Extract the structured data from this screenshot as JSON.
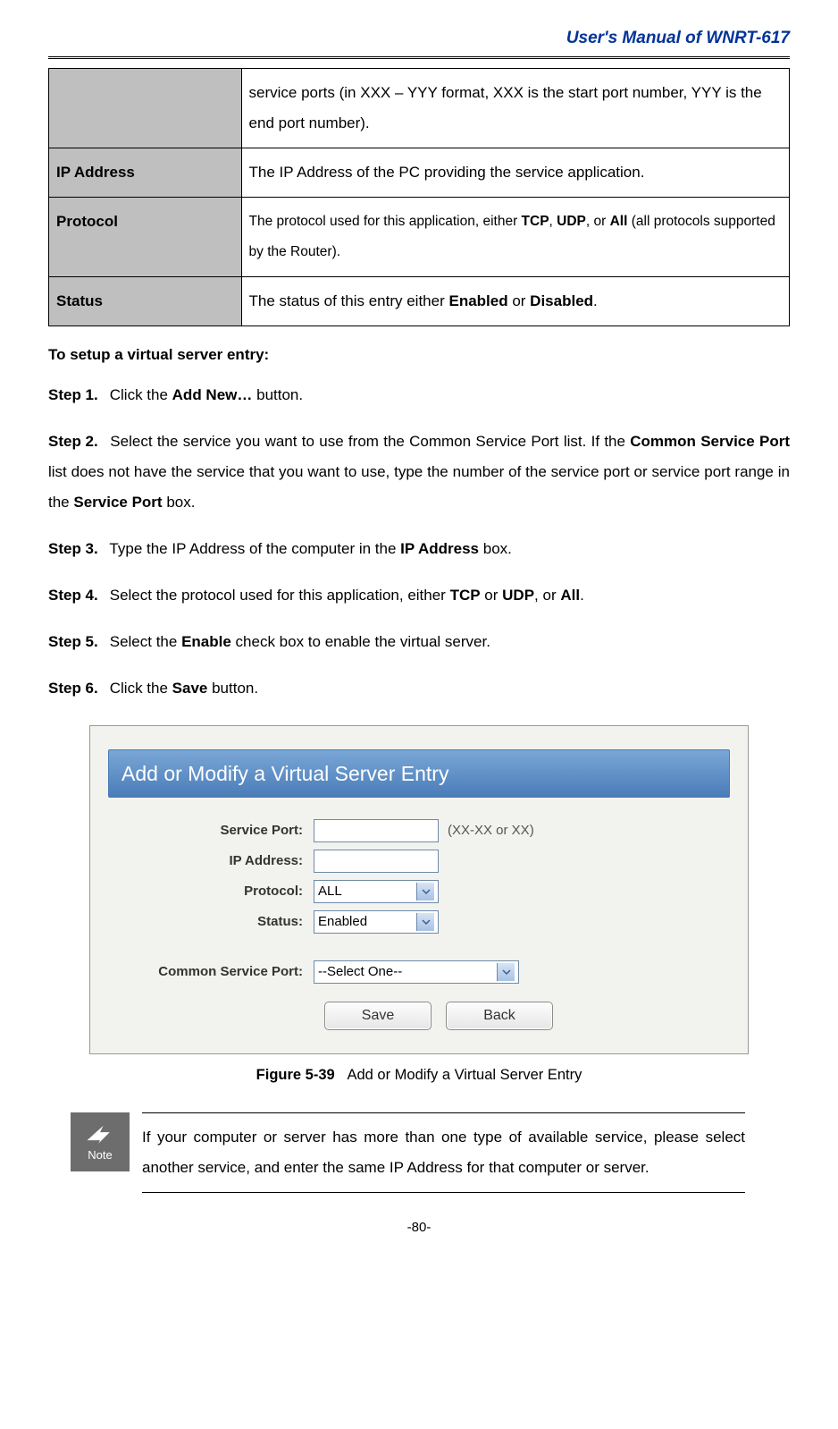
{
  "header": "User's  Manual  of  WNRT-617",
  "table": {
    "row0_desc": "service ports (in XXX – YYY format, XXX is the start port number, YYY is the end port number).",
    "row1_label": "IP Address",
    "row1_desc": "The IP Address of the PC providing the service application.",
    "row2_label": "Protocol",
    "row2_desc_pre": "The protocol used for this application, either ",
    "row2_tcp": "TCP",
    "row2_c1": ", ",
    "row2_udp": "UDP",
    "row2_c2": ", or ",
    "row2_all": "All",
    "row2_desc_post": " (all protocols supported by the Router).",
    "row3_label": "Status",
    "row3_pre": "The status of this entry either ",
    "row3_enabled": "Enabled",
    "row3_or": " or ",
    "row3_disabled": "Disabled",
    "row3_dot": "."
  },
  "section_heading": "To setup a virtual server entry:",
  "steps": {
    "s1_label": "Step 1.",
    "s1_pre": "Click the ",
    "s1_bold": "Add New…",
    "s1_post": " button.",
    "s2_label": "Step 2.",
    "s2_pre": "Select the service you want to use from the Common Service Port list. If the ",
    "s2_b1": "Common Service Port",
    "s2_mid": " list does not have the service that you want to use, type the number of the service port or service port range in the ",
    "s2_b2": "Service Port",
    "s2_post": " box.",
    "s3_label": "Step 3.",
    "s3_pre": "Type the IP Address of the computer in the ",
    "s3_bold": "IP Address",
    "s3_post": " box.",
    "s4_label": "Step 4.",
    "s4_pre": "Select the protocol used for this application, either ",
    "s4_tcp": "TCP",
    "s4_or1": " or ",
    "s4_udp": "UDP",
    "s4_or2": ", or ",
    "s4_all": "All",
    "s4_dot": ".",
    "s5_label": "Step 5.",
    "s5_pre": "Select the ",
    "s5_bold": "Enable",
    "s5_post": " check box to enable the virtual server.",
    "s6_label": "Step 6.",
    "s6_pre": "Click the ",
    "s6_bold": "Save",
    "s6_post": " button."
  },
  "figure": {
    "title": "Add or Modify a Virtual Server Entry",
    "labels": {
      "service_port": "Service Port:",
      "ip_address": "IP Address:",
      "protocol": "Protocol:",
      "status": "Status:",
      "common_service_port": "Common Service Port:"
    },
    "hint": "(XX-XX or XX)",
    "values": {
      "protocol": "ALL",
      "status": "Enabled",
      "common_service_port": "--Select One--"
    },
    "buttons": {
      "save": "Save",
      "back": "Back"
    },
    "caption_label": "Figure 5-39",
    "caption_text": "Add or Modify a Virtual Server Entry"
  },
  "note": {
    "word": "Note",
    "text": "If your computer or server has more than one type of available service, please select another service, and enter the same IP Address for that computer or server."
  },
  "page_number": "-80-"
}
